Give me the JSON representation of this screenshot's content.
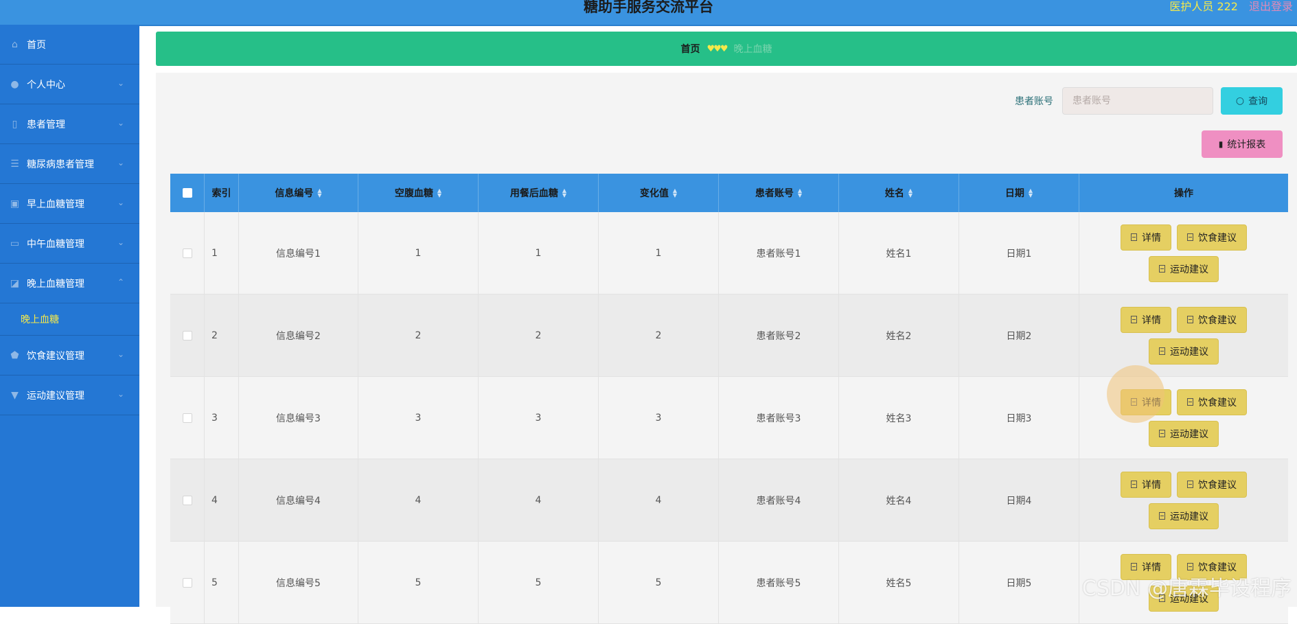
{
  "header": {
    "title": "糖助手服务交流平台",
    "user": "医护人员 222",
    "logout": "退出登录"
  },
  "sidebar": {
    "items": [
      {
        "label": "首页",
        "icon": "home-icon"
      },
      {
        "label": "个人中心",
        "icon": "user-icon"
      },
      {
        "label": "患者管理",
        "icon": "phone-icon"
      },
      {
        "label": "糖尿病患者管理",
        "icon": "list-icon"
      },
      {
        "label": "早上血糖管理",
        "icon": "clipboard-icon"
      },
      {
        "label": "中午血糖管理",
        "icon": "monitor-icon"
      },
      {
        "label": "晚上血糖管理",
        "icon": "chart-icon"
      },
      {
        "label": "饮食建议管理",
        "icon": "shield-icon"
      },
      {
        "label": "运动建议管理",
        "icon": "pin-icon"
      }
    ],
    "submenu_active": "晚上血糖"
  },
  "breadcrumb": {
    "home": "首页",
    "separator": "♥♥♥",
    "current": "晚上血糖"
  },
  "search": {
    "label": "患者账号",
    "placeholder": "患者账号",
    "query_button": "查询"
  },
  "toolbar": {
    "report_button": "统计报表"
  },
  "table": {
    "headers": [
      "索引",
      "信息编号",
      "空腹血糖",
      "用餐后血糖",
      "变化值",
      "患者账号",
      "姓名",
      "日期",
      "操作"
    ],
    "rows": [
      {
        "index": "1",
        "info_no": "信息编号1",
        "fasting": "1",
        "after_meal": "1",
        "change": "1",
        "account": "患者账号1",
        "name": "姓名1",
        "date": "日期1"
      },
      {
        "index": "2",
        "info_no": "信息编号2",
        "fasting": "2",
        "after_meal": "2",
        "change": "2",
        "account": "患者账号2",
        "name": "姓名2",
        "date": "日期2"
      },
      {
        "index": "3",
        "info_no": "信息编号3",
        "fasting": "3",
        "after_meal": "3",
        "change": "3",
        "account": "患者账号3",
        "name": "姓名3",
        "date": "日期3"
      },
      {
        "index": "4",
        "info_no": "信息编号4",
        "fasting": "4",
        "after_meal": "4",
        "change": "4",
        "account": "患者账号4",
        "name": "姓名4",
        "date": "日期4"
      },
      {
        "index": "5",
        "info_no": "信息编号5",
        "fasting": "5",
        "after_meal": "5",
        "change": "5",
        "account": "患者账号5",
        "name": "姓名5",
        "date": "日期5"
      }
    ],
    "actions": {
      "detail": "详情",
      "diet": "饮食建议",
      "exercise": "运动建议"
    }
  },
  "watermark": "CSDN @唐霖毕设程序",
  "colors": {
    "topbar": "#3a93e0",
    "sidebar": "#2477d4",
    "breadcrumb": "#26bf88",
    "accent_yellow": "#f5e94a",
    "action_button": "#e5cf62",
    "query_button": "#33cfe0",
    "report_button": "#ef8fc2"
  }
}
